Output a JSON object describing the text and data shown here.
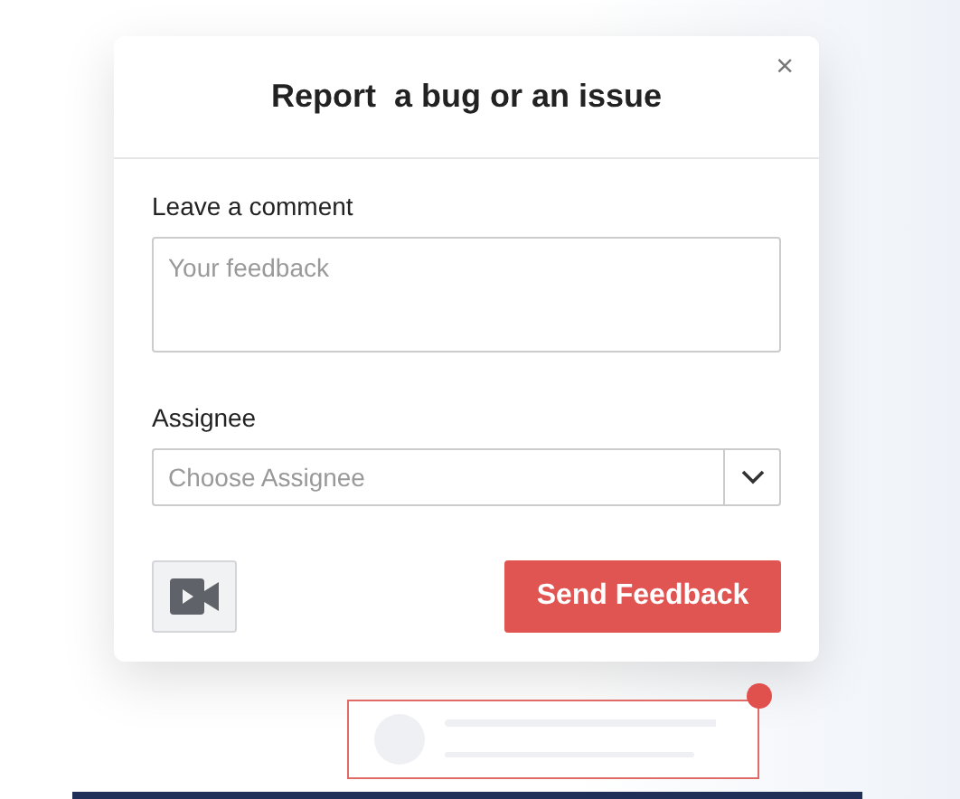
{
  "dialog": {
    "title": "Report  a bug or an issue",
    "close": "×"
  },
  "comment": {
    "label": "Leave a comment",
    "placeholder": "Your feedback"
  },
  "assignee": {
    "label": "Assignee",
    "placeholder": "Choose Assignee"
  },
  "buttons": {
    "send": "Send Feedback"
  }
}
